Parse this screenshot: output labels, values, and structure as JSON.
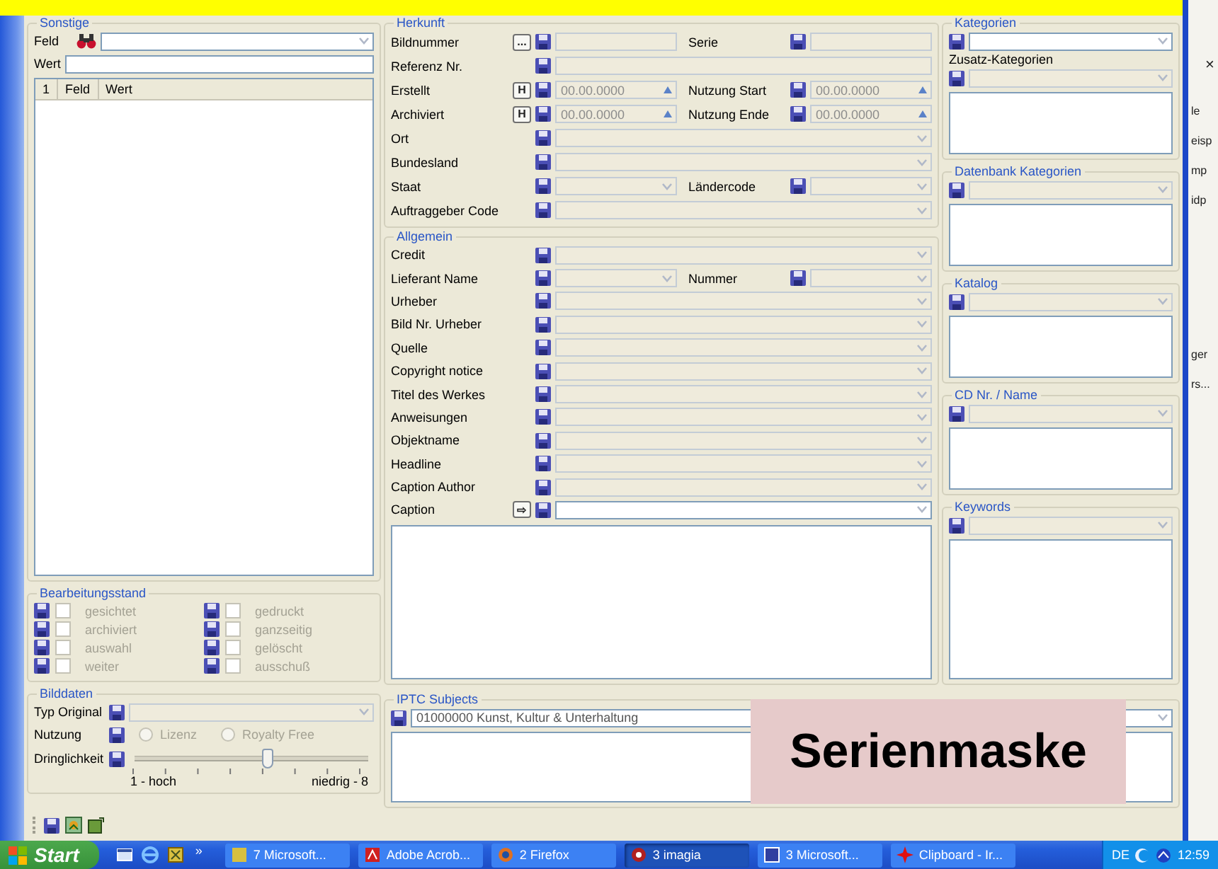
{
  "sonstige": {
    "title": "Sonstige",
    "feld_label": "Feld",
    "wert_label": "Wert",
    "columns": [
      "1",
      "Feld",
      "Wert"
    ]
  },
  "bearbeitungsstand": {
    "title": "Bearbeitungsstand",
    "items": [
      {
        "label": "gesichtet",
        "checked": false,
        "disabled": true
      },
      {
        "label": "gedruckt",
        "checked": false,
        "disabled": true
      },
      {
        "label": "archiviert",
        "checked": false,
        "disabled": true
      },
      {
        "label": "ganzseitig",
        "checked": false,
        "disabled": true
      },
      {
        "label": "auswahl",
        "checked": false,
        "disabled": true
      },
      {
        "label": "gelöscht",
        "checked": false,
        "disabled": true
      },
      {
        "label": "weiter",
        "checked": false,
        "disabled": true
      },
      {
        "label": "ausschuß",
        "checked": false,
        "disabled": true
      }
    ]
  },
  "bilddaten": {
    "title": "Bilddaten",
    "typ_original": {
      "label": "Typ Original",
      "disabled": true
    },
    "nutzung": {
      "label": "Nutzung",
      "disabled": true,
      "options": [
        {
          "label": "Lizenz",
          "selected": false
        },
        {
          "label": "Royalty Free",
          "selected": false
        }
      ]
    },
    "dringlichkeit": {
      "label": "Dringlichkeit",
      "level": 0.57,
      "min_label": "1 - hoch",
      "max_label": "niedrig - 8"
    }
  },
  "herkunft": {
    "title": "Herkunft",
    "rows": [
      {
        "label": "Bildnummer",
        "button": "...",
        "kind": "text",
        "disabled": true,
        "second": {
          "label": "Serie",
          "kind": "text",
          "disabled": true
        }
      },
      {
        "label": "Referenz Nr.",
        "kind": "text",
        "disabled": true
      },
      {
        "label": "Erstellt",
        "button": "H",
        "kind": "date",
        "value": "00.00.0000",
        "disabled": true,
        "second": {
          "label": "Nutzung Start",
          "kind": "date",
          "value": "00.00.0000",
          "disabled": true
        }
      },
      {
        "label": "Archiviert",
        "button": "H",
        "kind": "date",
        "value": "00.00.0000",
        "disabled": true,
        "second": {
          "label": "Nutzung Ende",
          "kind": "date",
          "value": "00.00.0000",
          "disabled": true
        }
      },
      {
        "label": "Ort",
        "kind": "combo",
        "disabled": true
      },
      {
        "label": "Bundesland",
        "kind": "combo",
        "disabled": true
      },
      {
        "label": "Staat",
        "kind": "combo",
        "disabled": true,
        "second": {
          "label": "Ländercode",
          "kind": "combo",
          "disabled": true
        }
      },
      {
        "label": "Auftraggeber Code",
        "kind": "combo",
        "disabled": true
      }
    ]
  },
  "allgemein": {
    "title": "Allgemein",
    "rows": [
      {
        "label": "Credit",
        "kind": "combo",
        "disabled": true
      },
      {
        "label": "Lieferant Name",
        "kind": "combo",
        "disabled": true,
        "second": {
          "label": "Nummer",
          "kind": "combo",
          "disabled": true
        }
      },
      {
        "label": "Urheber",
        "kind": "combo",
        "disabled": true
      },
      {
        "label": "Bild Nr. Urheber",
        "kind": "combo",
        "disabled": true
      },
      {
        "label": "Quelle",
        "kind": "combo",
        "disabled": true
      },
      {
        "label": "Copyright notice",
        "kind": "combo",
        "disabled": true
      },
      {
        "label": "Titel des Werkes",
        "kind": "combo",
        "disabled": true
      },
      {
        "label": "Anweisungen",
        "kind": "combo",
        "disabled": true
      },
      {
        "label": "Objektname",
        "kind": "combo",
        "disabled": true
      },
      {
        "label": "Headline",
        "kind": "combo",
        "disabled": true
      },
      {
        "label": "Caption Author",
        "kind": "combo",
        "disabled": true
      },
      {
        "label": "Caption",
        "button": "⇨",
        "kind": "combo",
        "disabled": false
      }
    ]
  },
  "right_groups": [
    {
      "title": "Kategorien",
      "parts": [
        {
          "kind": "combo",
          "disabled": false
        },
        {
          "kind": "label",
          "text": "Zusatz-Kategorien"
        },
        {
          "kind": "combo",
          "disabled": true
        },
        {
          "kind": "list"
        }
      ]
    },
    {
      "title": "Datenbank Kategorien",
      "parts": [
        {
          "kind": "combo",
          "disabled": true
        },
        {
          "kind": "list"
        }
      ]
    },
    {
      "title": "Katalog",
      "parts": [
        {
          "kind": "combo",
          "disabled": true
        },
        {
          "kind": "list"
        }
      ]
    },
    {
      "title": "CD Nr. / Name",
      "parts": [
        {
          "kind": "combo",
          "disabled": true
        },
        {
          "kind": "list"
        }
      ]
    },
    {
      "title": "Keywords",
      "parts": [
        {
          "kind": "combo",
          "disabled": true
        },
        {
          "kind": "list"
        }
      ]
    }
  ],
  "iptc": {
    "title": "IPTC Subjects",
    "value": "01000000 Kunst, Kultur & Unterhaltung"
  },
  "annotation": {
    "text": "Serienmaske"
  },
  "taskbar": {
    "start": "Start",
    "overflow": "»",
    "tasks": [
      {
        "label": "7 Microsoft...",
        "selected": false
      },
      {
        "label": "Adobe Acrob...",
        "selected": false
      },
      {
        "label": "2 Firefox",
        "selected": false
      },
      {
        "label": "3 imagia",
        "selected": true
      },
      {
        "label": "3 Microsoft...",
        "selected": false
      },
      {
        "label": "Clipboard - Ir...",
        "selected": false
      }
    ],
    "language": "DE",
    "clock": "12:59"
  },
  "background_window": {
    "close_glyph": "×",
    "fragments": [
      "le",
      "eisp",
      "mp",
      "idp",
      "ger",
      "rs..."
    ]
  }
}
